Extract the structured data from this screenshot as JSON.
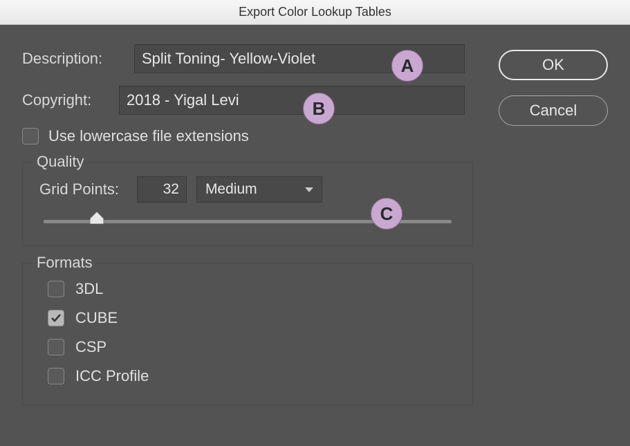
{
  "title": "Export Color Lookup Tables",
  "description": {
    "label": "Description:",
    "value": "Split Toning- Yellow-Violet"
  },
  "copyright": {
    "label": "Copyright:",
    "value": "2018 - Yigal Levi"
  },
  "buttons": {
    "ok": "OK",
    "cancel": "Cancel"
  },
  "lowercase": {
    "checked": false,
    "label": "Use lowercase file extensions"
  },
  "quality": {
    "legend": "Quality",
    "grid_label": "Grid Points:",
    "grid_value": "32",
    "preset": "Medium",
    "slider_percent": 13
  },
  "formats": {
    "legend": "Formats",
    "items": [
      {
        "label": "3DL",
        "checked": false
      },
      {
        "label": "CUBE",
        "checked": true
      },
      {
        "label": "CSP",
        "checked": false
      },
      {
        "label": "ICC Profile",
        "checked": false
      }
    ]
  },
  "callouts": {
    "a": "A",
    "b": "B",
    "c": "C"
  }
}
